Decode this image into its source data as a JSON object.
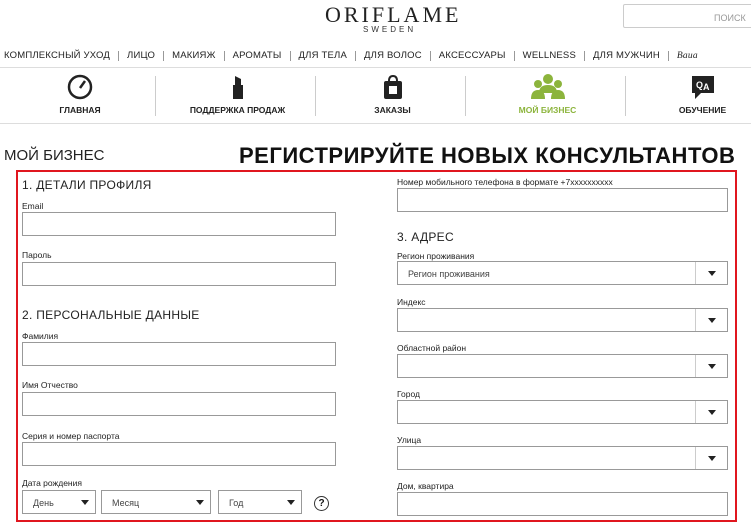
{
  "header": {
    "logo_main": "ORIFLAME",
    "logo_sub": "SWEDEN",
    "search_placeholder": "ПОИСК"
  },
  "categories": [
    "КОМПЛЕКСНЫЙ УХОД",
    "ЛИЦО",
    "МАКИЯЖ",
    "АРОМАТЫ",
    "ДЛЯ ТЕЛА",
    "ДЛЯ ВОЛОС",
    "АКСЕССУАРЫ",
    "WELLNESS",
    "ДЛЯ МУЖЧИН",
    "Baua"
  ],
  "icon_nav": [
    {
      "label": "ГЛАВНАЯ",
      "icon": "gauge-icon"
    },
    {
      "label": "ПОДДЕРЖКА ПРОДАЖ",
      "icon": "lipstick-icon"
    },
    {
      "label": "ЗАКАЗЫ",
      "icon": "bag-icon"
    },
    {
      "label": "МОЙ БИЗНЕС",
      "icon": "people-icon",
      "active": true
    },
    {
      "label": "ОБУЧЕНИЕ",
      "icon": "qa-icon"
    }
  ],
  "page": {
    "my_business": "МОЙ БИЗНЕС",
    "headline": "РЕГИСТРИРУЙТЕ НОВЫХ КОНСУЛЬТАНТОВ"
  },
  "form": {
    "section1": "1. ДЕТАЛИ ПРОФИЛЯ",
    "email_label": "Email",
    "password_label": "Пароль",
    "section2": "2. ПЕРСОНАЛЬНЫЕ ДАННЫЕ",
    "surname_label": "Фамилия",
    "name_label": "Имя Отчество",
    "passport_label": "Серия и номер паспорта",
    "birthdate_label": "Дата рождения",
    "day_placeholder": "День",
    "month_placeholder": "Месяц",
    "year_placeholder": "Год",
    "help": "?",
    "phone_label": "Номер мобильного телефона в формате  +7xxxxxxxxxx",
    "section3": "3. АДРЕС",
    "region_label": "Регион проживания",
    "region_value": "Регион проживания",
    "index_label": "Индекс",
    "district_label": "Областной район",
    "city_label": "Город",
    "street_label": "Улица",
    "house_label": "Дом, квартира"
  },
  "colors": {
    "accent": "#8cb43c",
    "frame": "#e0161f"
  }
}
